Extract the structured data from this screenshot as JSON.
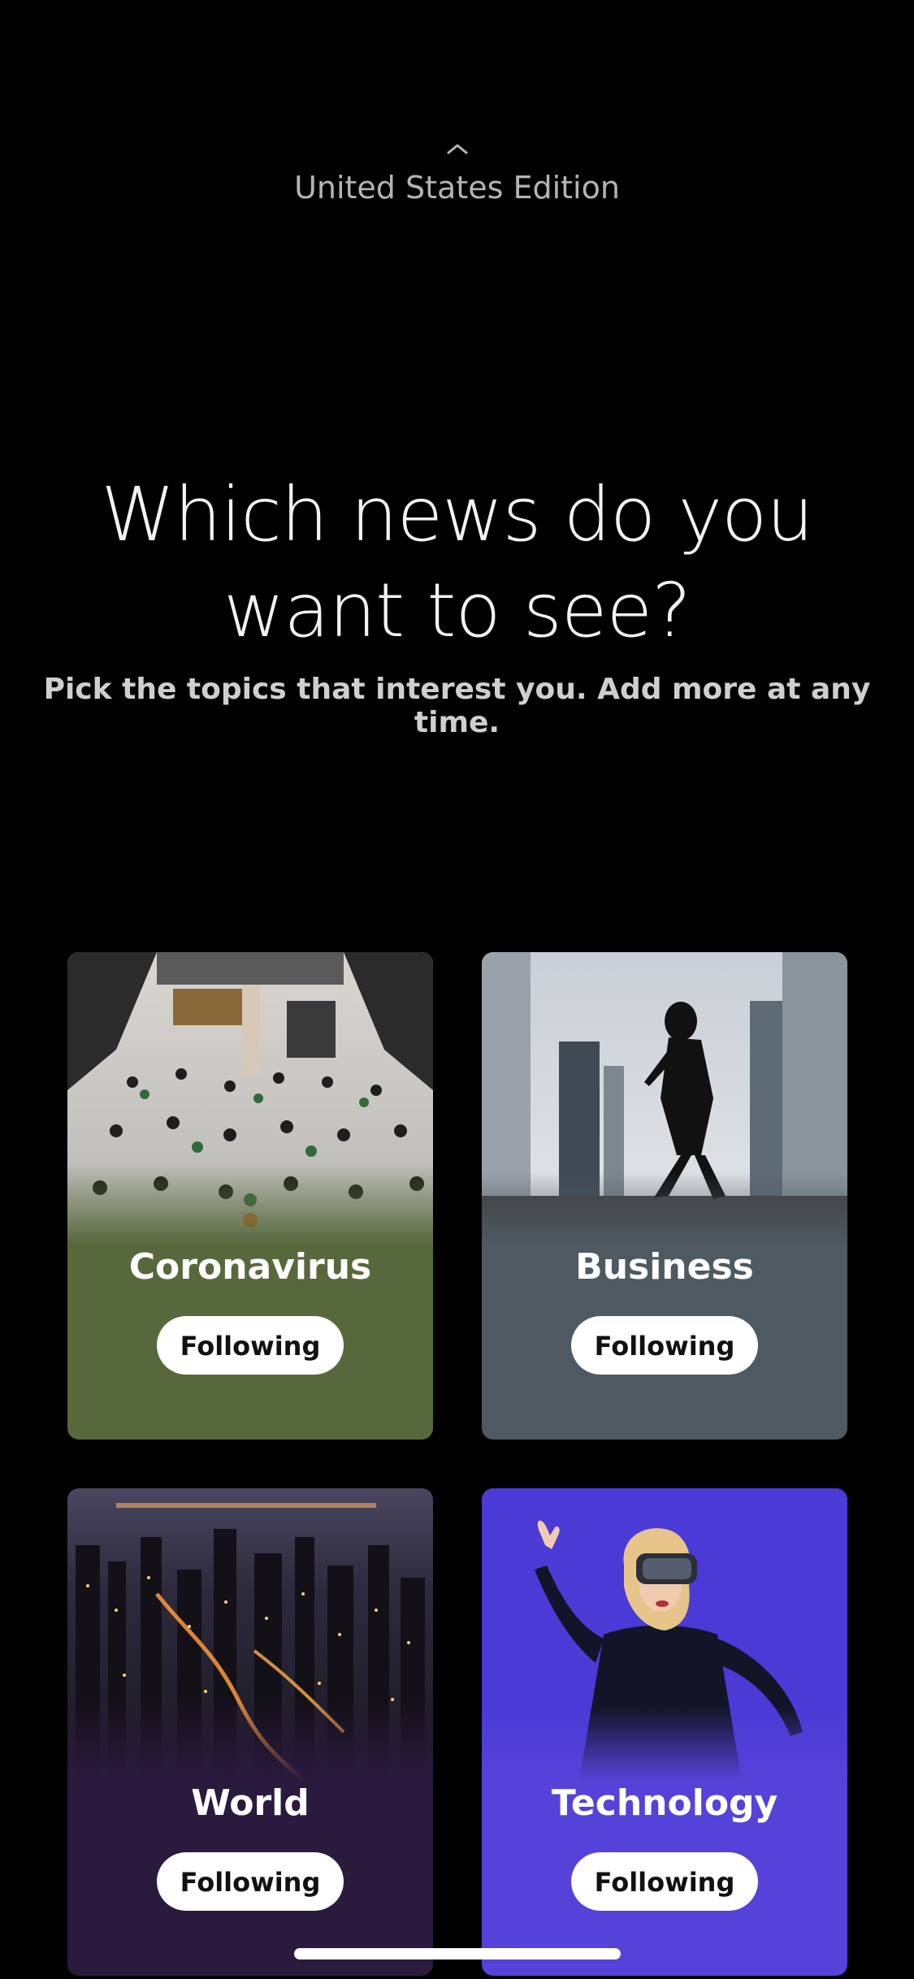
{
  "header": {
    "edition_label": "United States Edition",
    "chevron_icon": "chevron-up-icon"
  },
  "intro": {
    "title": "Which news do you want to see?",
    "subtitle": "Pick the topics that interest you. Add more at any time."
  },
  "topics": [
    {
      "name": "Coronavirus",
      "button_label": "Following",
      "color": "#58683d",
      "image": "socially-distanced-seating-photo"
    },
    {
      "name": "Business",
      "button_label": "Following",
      "color": "#4f5961",
      "image": "businesswoman-silhouette-photo"
    },
    {
      "name": "World",
      "button_label": "Following",
      "color": "#2a1a3e",
      "image": "city-at-night-photo"
    },
    {
      "name": "Technology",
      "button_label": "Following",
      "color": "#5542d8",
      "image": "vr-headset-woman-photo"
    }
  ]
}
